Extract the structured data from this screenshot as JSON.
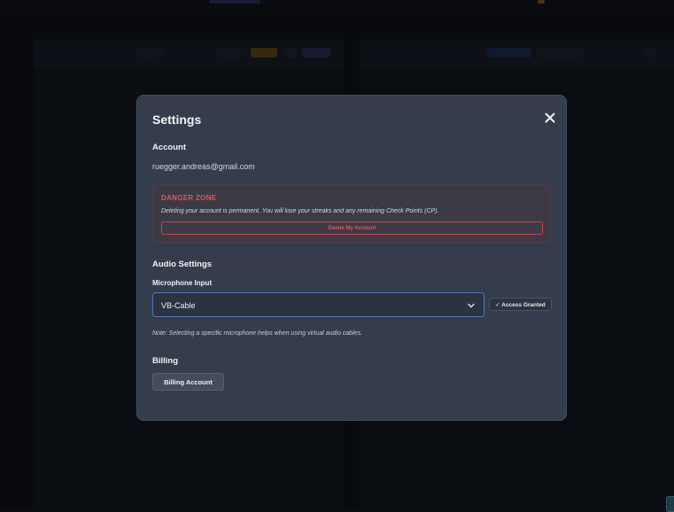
{
  "modal": {
    "title": "Settings",
    "account": {
      "heading": "Account",
      "email": "ruegger.andreas@gmail.com",
      "danger_zone": {
        "title": "DANGER ZONE",
        "text": "Deleting your account is permanent. You will lose your streaks and any remaining Check Points (CP).",
        "delete_button": "Delete My Account"
      }
    },
    "audio": {
      "heading": "Audio Settings",
      "mic_label": "Microphone Input",
      "mic_selected": "VB-Cable",
      "access_badge": "✓ Access Granted",
      "note": "Note: Selecting a specific microphone helps when using virtual audio cables."
    },
    "billing": {
      "heading": "Billing",
      "button": "Billing Account"
    }
  },
  "icons": {
    "close": "close-icon",
    "chevron": "chevron-down-icon"
  },
  "colors": {
    "modal_bg": "#353c4b",
    "danger": "#e0545a",
    "select_border": "#4c78b6"
  }
}
